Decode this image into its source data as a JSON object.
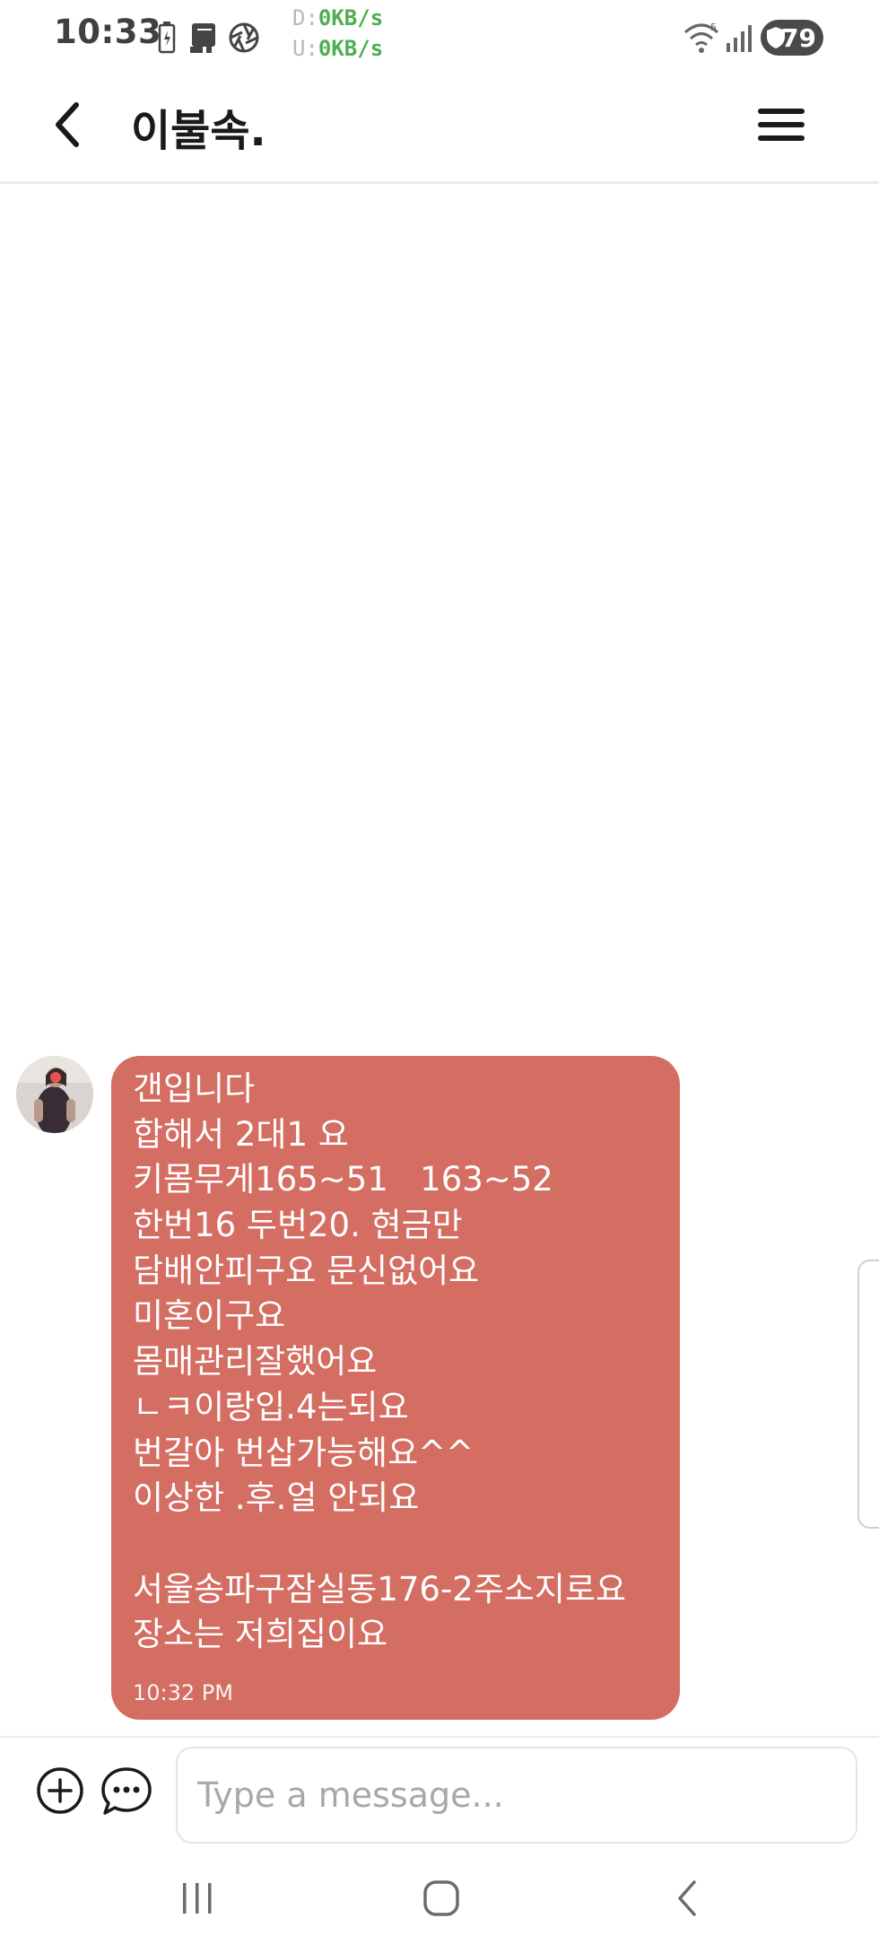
{
  "status_bar": {
    "time": "10:33",
    "net_download_label": "D:",
    "net_download_value": "0KB/s",
    "net_upload_label": "U:",
    "net_upload_value": "0KB/s",
    "battery_level": "79",
    "icons": [
      "battery-saver-icon",
      "notification-icon",
      "aperture-icon",
      "wifi-icon",
      "signal-icon",
      "battery-icon"
    ]
  },
  "header": {
    "title": "이불속.",
    "icons": [
      "back-arrow-icon",
      "menu-icon"
    ]
  },
  "conversation": {
    "message": {
      "lines": [
        "갠입니다",
        "합해서 2대1 요",
        "키몸무게165~51   163~52",
        "한번16 두번20. 현금만",
        "담배안피구요 문신없어요",
        "미혼이구요",
        "몸매관리잘했어요",
        "ㄴㅋ이랑입.4는되요",
        "번갈아 번삽가능해요^^",
        "이상한 .후.얼 안되요",
        "",
        "서울송파구잠실동176-2주소지로요",
        "장소는 저희집이요"
      ],
      "time": "10:32 PM",
      "bubble_color": "#d46d62"
    }
  },
  "input": {
    "placeholder": "Type a message...",
    "value": "",
    "icons": [
      "add-circle-icon",
      "chat-bubble-dots-icon"
    ]
  },
  "nav_bar": {
    "icons": [
      "recent-apps-icon",
      "home-icon",
      "back-icon"
    ]
  }
}
